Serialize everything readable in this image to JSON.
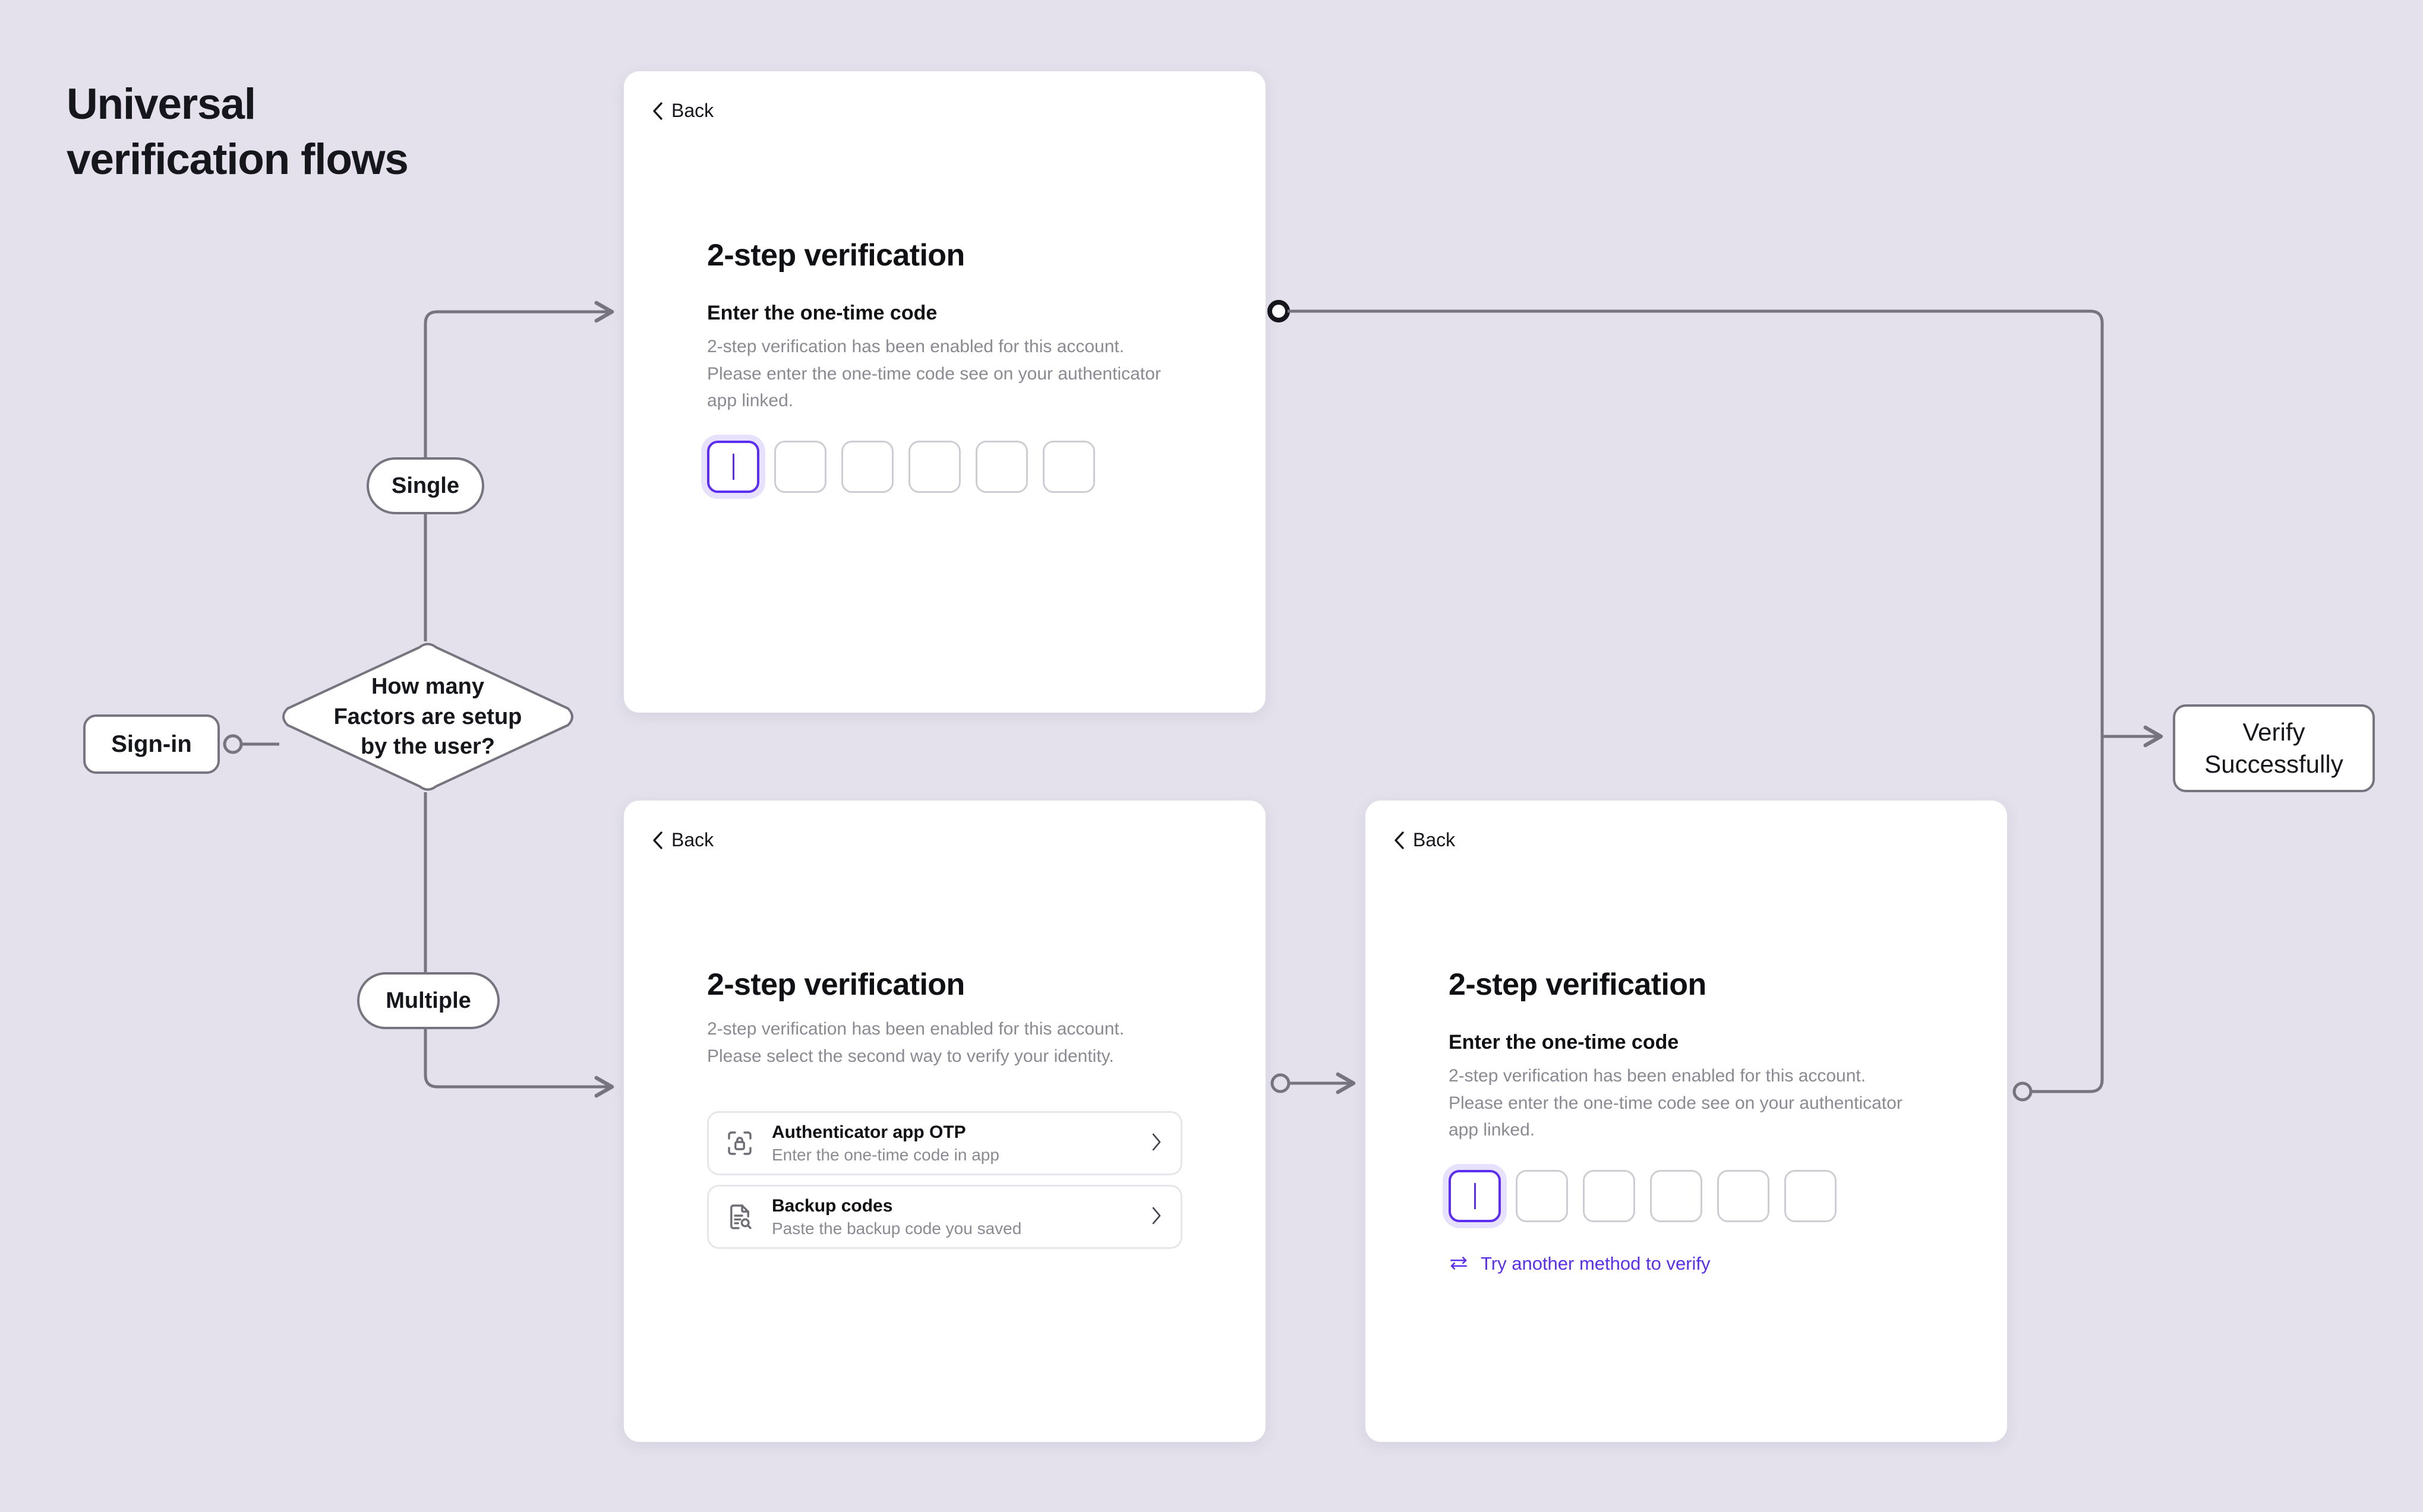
{
  "page": {
    "title": "Universal\nverification flows",
    "background_color": "#e4e1ec",
    "accent_color": "#5b2ef0",
    "line_color": "#76747f"
  },
  "flow": {
    "start_node": {
      "label": "Sign-in"
    },
    "decision_node": {
      "label": "How many\nFactors are setup\nby the user?"
    },
    "branch_single": {
      "label": "Single"
    },
    "branch_multiple": {
      "label": "Multiple"
    },
    "end_node": {
      "label": "Verify\nSuccessfully"
    }
  },
  "card_single": {
    "back_label": "Back",
    "back_icon": "chevron-left-icon",
    "title": "2-step verification",
    "section_label": "Enter the one-time code",
    "description": "2-step verification has been enabled for this account.\nPlease enter the one-time code see on your authenticator\napp linked.",
    "otp": {
      "length": 6,
      "active_index": 0,
      "values": [
        "",
        "",
        "",
        "",
        "",
        ""
      ]
    }
  },
  "card_methods": {
    "back_label": "Back",
    "back_icon": "chevron-left-icon",
    "title": "2-step verification",
    "description": "2-step verification has been enabled for this account.\nPlease select the second way to verify your identity.",
    "methods": [
      {
        "icon": "scan-lock-icon",
        "title": "Authenticator app OTP",
        "subtitle": "Enter the one-time code in app",
        "chevron": "chevron-right-icon"
      },
      {
        "icon": "document-search-icon",
        "title": "Backup codes",
        "subtitle": "Paste the backup code you saved",
        "chevron": "chevron-right-icon"
      }
    ]
  },
  "card_multi": {
    "back_label": "Back",
    "back_icon": "chevron-left-icon",
    "title": "2-step verification",
    "section_label": "Enter the one-time code",
    "description": "2-step verification has been enabled for this account.\nPlease enter the one-time code see on your authenticator\napp linked.",
    "otp": {
      "length": 6,
      "active_index": 0,
      "values": [
        "",
        "",
        "",
        "",
        "",
        ""
      ]
    },
    "try_another": {
      "icon": "swap-arrows-icon",
      "label": "Try another method to verify"
    }
  }
}
